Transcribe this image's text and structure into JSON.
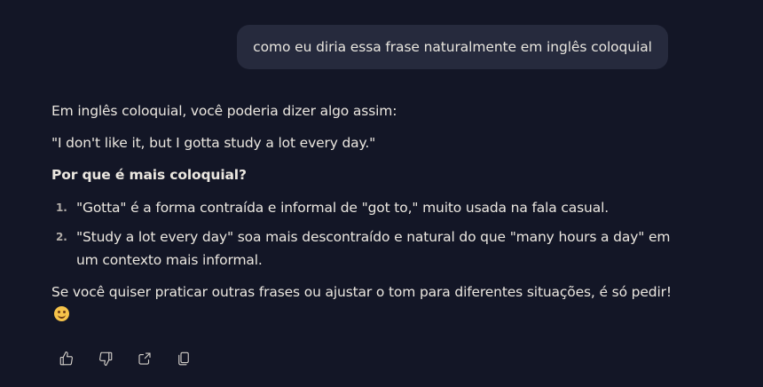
{
  "user_message": "como eu diria essa frase naturalmente em inglês coloquial",
  "assistant": {
    "intro": "Em inglês coloquial, você poderia dizer algo assim:",
    "quote": "\"I don't like it, but I gotta study a lot every day.\"",
    "heading": "Por que é mais coloquial?",
    "points": [
      {
        "num": "1.",
        "text": "\"Gotta\" é a forma contraída e informal de \"got to,\" muito usada na fala casual."
      },
      {
        "num": "2.",
        "text": "\"Study a lot every day\" soa mais descontraído e natural do que \"many hours a day\" em um contexto mais informal."
      }
    ],
    "closing": "Se você quiser praticar outras frases ou ajustar o tom para diferentes situações, é só pedir!",
    "emoji": "smiling-face"
  },
  "actions": {
    "icons": [
      "thumbs-up-icon",
      "thumbs-down-icon",
      "share-icon",
      "copy-icon"
    ]
  },
  "colors": {
    "background": "#131626",
    "bubble": "#262a3d",
    "text": "#ebe7e0"
  }
}
